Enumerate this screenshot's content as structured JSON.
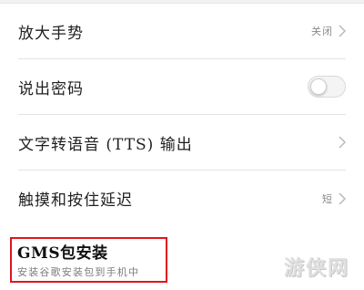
{
  "settings": {
    "items": [
      {
        "label": "放大手势",
        "value": "关闭",
        "control": "chevron"
      },
      {
        "label": "说出密码",
        "value": "",
        "control": "toggle",
        "toggle_on": false
      },
      {
        "label": "文字转语音 (TTS) 输出",
        "value": "",
        "control": "chevron"
      },
      {
        "label": "触摸和按住延迟",
        "value": "短",
        "control": "chevron"
      }
    ]
  },
  "gms": {
    "title": "GMS包安装",
    "subtitle": "安装谷歌安装包到手机中",
    "highlight_color": "#e0141e"
  },
  "watermark": {
    "text": "游侠网"
  },
  "colors": {
    "divider": "#e3e3e3",
    "secondary_text": "#8a8a8a",
    "highlight": "#e0141e"
  }
}
